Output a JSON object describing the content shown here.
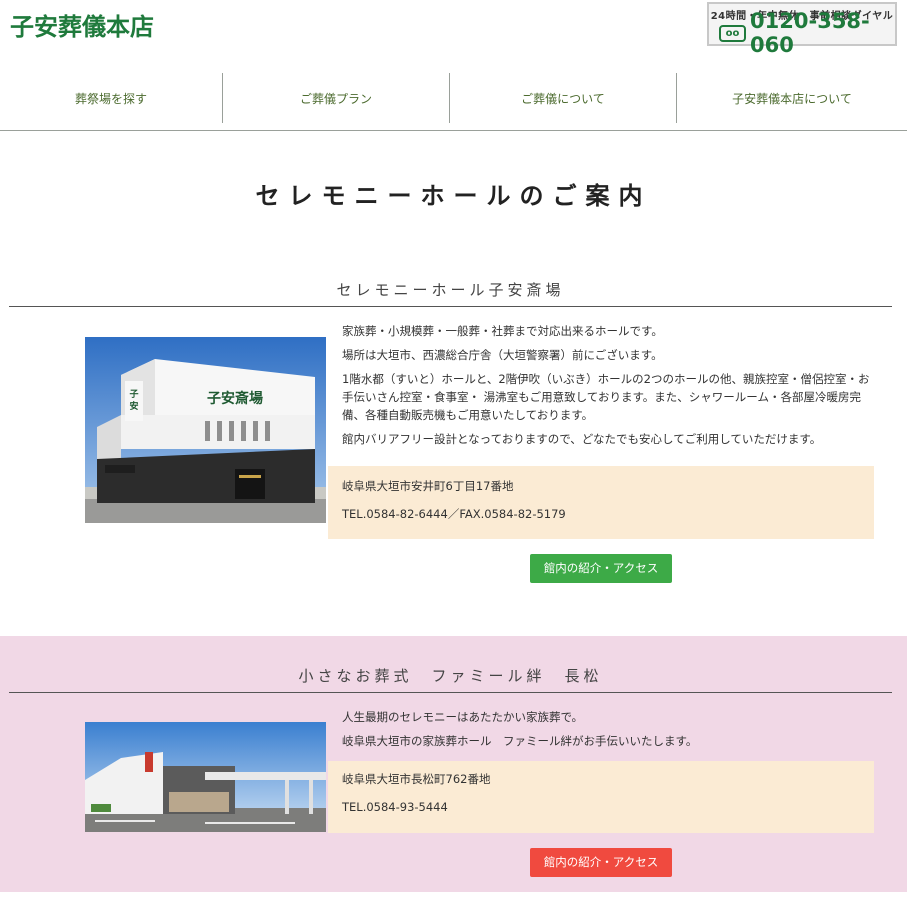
{
  "header": {
    "logo": "子安葬儀本店",
    "dial_caption": "24時間・年中無休　事前相談ダイヤル",
    "free_dial_icon": "oo",
    "phone": "0120-358-060"
  },
  "nav": {
    "items": [
      {
        "label": "葬祭場を探す"
      },
      {
        "label": "ご葬儀プラン"
      },
      {
        "label": "ご葬儀について"
      },
      {
        "label": "子安葬儀本店について"
      }
    ]
  },
  "page_title": "セレモニーホールのご案内",
  "halls": [
    {
      "title": "セレモニーホール子安斎場",
      "paragraphs": [
        "家族葬・小規模葬・一般葬・社葬まで対応出来るホールです。",
        "場所は大垣市、西濃総合庁舎（大垣警察署）前にございます。",
        "1階水都（すいと）ホールと、2階伊吹（いぶき）ホールの2つのホールの他、親族控室・僧侶控室・お手伝いさん控室・食事室・ 湯沸室もご用意致しております。また、シャワールーム・各部屋冷暖房完備、各種自動販売機もご用意いたしております。",
        "館内バリアフリー設計となっておりますので、どなたでも安心してご利用していただけます。"
      ],
      "address": "岐阜県大垣市安井町6丁目17番地",
      "tel": "TEL.0584-82-6444／FAX.0584-82-5179",
      "button": "館内の紹介・アクセス",
      "sign_text": "子安斎場",
      "button_color": "#3daa47"
    },
    {
      "title": "小さなお葬式　ファミール絆　長松",
      "paragraphs": [
        "人生最期のセレモニーはあたたかい家族葬で。",
        "岐阜県大垣市の家族葬ホール　ファミール絆がお手伝いいたします。"
      ],
      "address": "岐阜県大垣市長松町762番地",
      "tel": "TEL.0584-93-5444",
      "button": "館内の紹介・アクセス",
      "button_color": "#f04a3f",
      "band_color": "#f1d8e6"
    }
  ],
  "colors": {
    "brand_green": "#1f7a3c",
    "nav_text": "#4c6b2f",
    "address_bg": "#fbebd4"
  }
}
